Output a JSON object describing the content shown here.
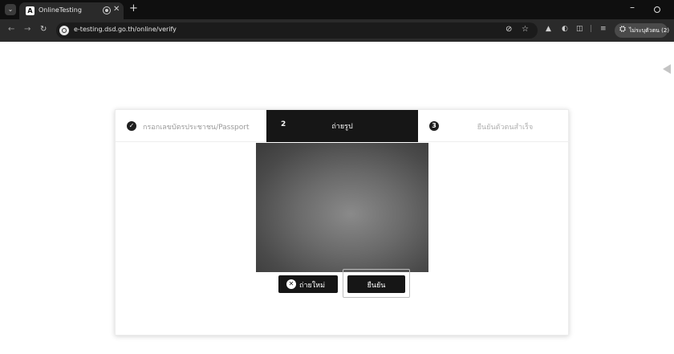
{
  "browser": {
    "tab_title": "OnlineTesting",
    "tab_icon_letter": "A",
    "url": "e-testing.dsd.go.th/online/verify",
    "profile_label": "ไม่ระบุตัวตน (2)",
    "icons": {
      "menu": "chevron-down-icon",
      "audio": "audio-icon",
      "close": "close-icon",
      "new_tab": "plus-icon",
      "minimize": "minimize-icon",
      "restore": "restore-icon",
      "back": "back-icon",
      "forward": "forward-icon",
      "reload": "reload-icon",
      "site_info": "site-info-icon",
      "eye_off": "eye-off-icon",
      "star": "star-icon",
      "extensions": "extension-icon",
      "incognito": "incognito-icon"
    }
  },
  "stepper": {
    "step1": {
      "label": "กรอกเลขบัตรประชาชน/Passport",
      "status": "completed"
    },
    "step2": {
      "number": "2",
      "label": "ถ่ายรูป",
      "status": "active"
    },
    "step3": {
      "number": "3",
      "label": "ยืนยันตัวตนสำเร็จ",
      "status": "pending"
    }
  },
  "camera": {
    "state": "preview"
  },
  "actions": {
    "retake_label": "ถ่ายใหม่",
    "confirm_label": "ยืนยัน"
  },
  "colors": {
    "active_step": "#161616",
    "button": "#161616",
    "chrome_dark": "#0f0f0f"
  }
}
